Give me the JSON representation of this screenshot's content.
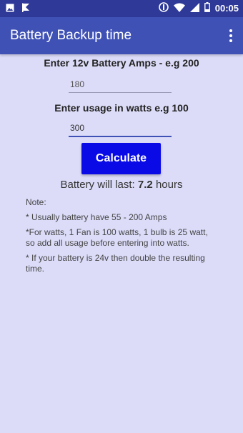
{
  "status_bar": {
    "time": "00:05",
    "icons": [
      "gallery-icon",
      "flag-icon",
      "dnd-icon",
      "wifi-icon",
      "signal-icon",
      "battery-icon"
    ]
  },
  "app_bar": {
    "title": "Battery Backup time",
    "menu_icon": "overflow-menu-icon"
  },
  "form": {
    "amps_label": "Enter 12v Battery Amps - e.g 200",
    "amps_value": "180",
    "watts_label": "Enter usage in watts e.g 100",
    "watts_value": "300",
    "calculate_label": "Calculate"
  },
  "result": {
    "prefix": "Battery will last:",
    "value": "7.2",
    "suffix": "hours"
  },
  "notes": {
    "heading": "Note:",
    "items": [
      "* Usually battery have 55 - 200 Amps",
      "*For watts, 1 Fan is 100 watts, 1 bulb is 25 watt, so add all usage before entering into watts.",
      "* If your battery is 24v then double the resulting time."
    ]
  },
  "colors": {
    "status_bar": "#2f3a98",
    "app_bar": "#3f51b5",
    "background": "#dcdcf9",
    "button": "#0a0ae6"
  }
}
